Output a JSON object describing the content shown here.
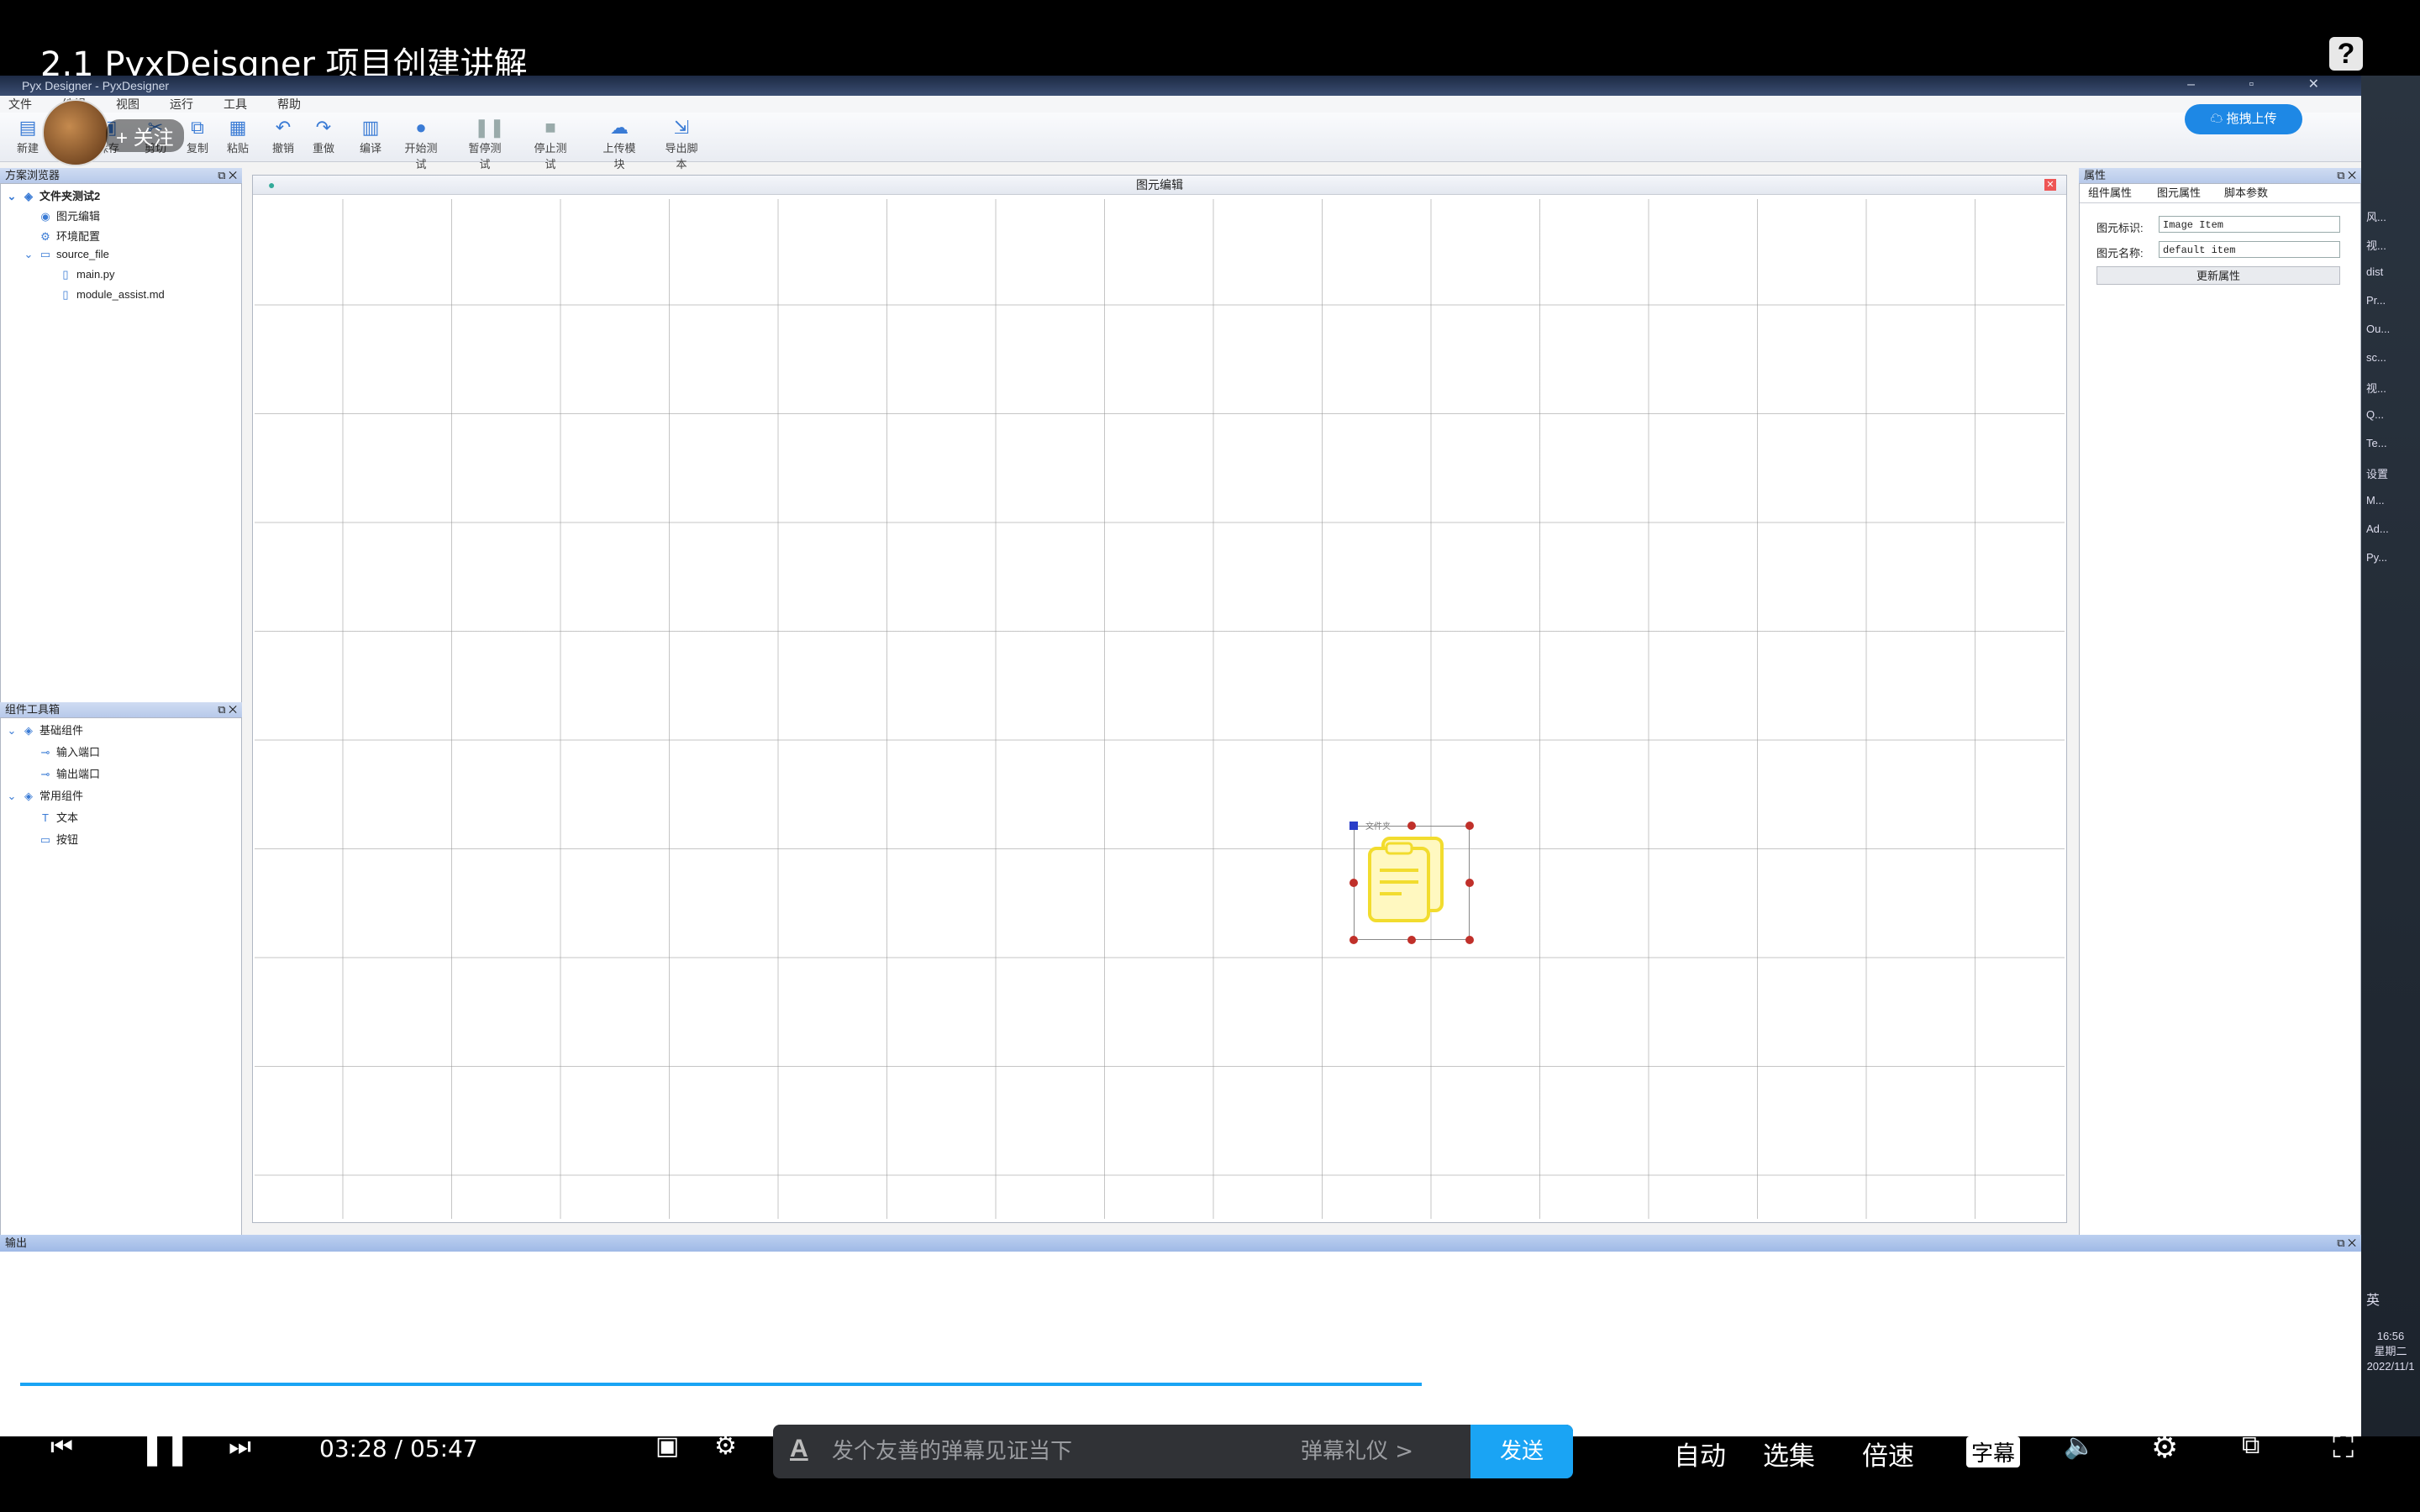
{
  "video": {
    "title": "2.1 PyxDeisgner 项目创建讲解",
    "follow_label": "+ 关注",
    "progress": 0.6,
    "time_current": "03:28",
    "time_separator": "/",
    "time_total": "05:47"
  },
  "app": {
    "window_title": "Pyx Designer - PyxDesigner",
    "menu": [
      "文件",
      "编辑",
      "视图",
      "运行",
      "工具",
      "帮助"
    ],
    "toolbar": [
      {
        "label": "新建",
        "icon": "new-file-icon"
      },
      {
        "label": "保存",
        "icon": "save-icon"
      },
      {
        "label": "剪切",
        "icon": "cut-icon"
      },
      {
        "label": "复制",
        "icon": "copy-icon"
      },
      {
        "label": "粘贴",
        "icon": "paste-icon"
      },
      {
        "label": "撤销",
        "icon": "undo-icon"
      },
      {
        "label": "重做",
        "icon": "redo-icon"
      },
      {
        "label": "编译",
        "icon": "compile-icon"
      },
      {
        "label": "开始测试",
        "icon": "play-icon"
      },
      {
        "label": "暂停测试",
        "icon": "pause-icon"
      },
      {
        "label": "停止测试",
        "icon": "stop-icon"
      },
      {
        "label": "上传模块",
        "icon": "cloud-upload-icon"
      },
      {
        "label": "导出脚本",
        "icon": "export-icon"
      }
    ],
    "cloud_button": "拖拽上传",
    "explorer": {
      "title": "方案浏览器",
      "items": [
        {
          "label": "文件夹测试2",
          "level": 0
        },
        {
          "label": "图元编辑",
          "level": 1
        },
        {
          "label": "环境配置",
          "level": 1
        },
        {
          "label": "source_file",
          "level": 1
        },
        {
          "label": "main.py",
          "level": 2
        },
        {
          "label": "module_assist.md",
          "level": 2
        }
      ]
    },
    "toolbox": {
      "title": "组件工具箱",
      "items": [
        {
          "label": "基础组件",
          "level": 0
        },
        {
          "label": "输入端口",
          "level": 1
        },
        {
          "label": "输出端口",
          "level": 1
        },
        {
          "label": "常用组件",
          "level": 0
        },
        {
          "label": "文本",
          "level": 1
        },
        {
          "label": "按钮",
          "level": 1
        }
      ]
    },
    "editor": {
      "title": "图元编辑",
      "item_label": "文件夹"
    },
    "properties": {
      "title": "属性",
      "tabs": [
        "组件属性",
        "图元属性",
        "脚本参数"
      ],
      "fields": [
        {
          "label": "图元标识:",
          "value": "Image Item"
        },
        {
          "label": "图元名称:",
          "value": "default item"
        }
      ],
      "update_button": "更新属性"
    },
    "output": {
      "title": "输出"
    }
  },
  "taskbar": {
    "entries": [
      "风...",
      "视...",
      "dist",
      "Pr...",
      "Ou...",
      "sc...",
      "视...",
      "Q...",
      "Te...",
      "设置",
      "M...",
      "Ad...",
      "Py..."
    ],
    "ime": "英",
    "time": "16:56",
    "weekday": "星期二",
    "date": "2022/11/1"
  },
  "controls": {
    "danmaku_placeholder": "发个友善的弹幕见证当下",
    "danmaku_etiquette": "弹幕礼仪 >",
    "send": "发送",
    "auto": "自动",
    "episodes": "选集",
    "speed": "倍速",
    "subtitle": "字幕"
  },
  "colors": {
    "accent": "#1aa4f4",
    "panel_header": "#b7c9ea",
    "handle": "#c0302a"
  }
}
